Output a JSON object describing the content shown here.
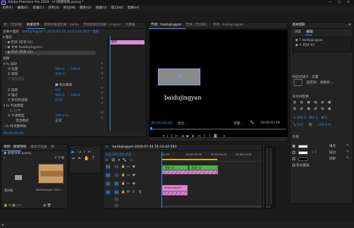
{
  "app": {
    "title": "Adobe Premiere Pro 2020 - H:\\新建项目.prproj *"
  },
  "menu": [
    "文件(F)",
    "编辑(E)",
    "剪辑(C)",
    "序列(S)",
    "标记(M)",
    "图形(G)",
    "视图(V)",
    "窗口(W)",
    "帮助(H)"
  ],
  "source_panel": {
    "tabs": [
      "源：(无剪辑)",
      "效果控件",
      "音频剪辑混合器：baidu",
      "音频剪辑混合器：jingyan",
      "元数据"
    ],
    "active_tab": "效果控件",
    "header": "主要＊图形",
    "sequence": "baidujingyan * 2020-07-24 14-13-42-563 * 图形",
    "sections": {
      "graphics": "图形",
      "shape": "形状 (形状 01)",
      "text": "文本 (baidujingyan)",
      "shape2": "形状 (形状 02)"
    },
    "video_label": "视频",
    "motion": "运动",
    "props": [
      {
        "name": "位置",
        "value": "960.0",
        "value2": "540.0"
      },
      {
        "name": "缩放",
        "value": "100.0"
      },
      {
        "name": "缩放宽度",
        "value": ""
      },
      {
        "name": "旋转",
        "value": "0.0"
      },
      {
        "name": "锚点",
        "value": "960.0",
        "value2": "540.0"
      },
      {
        "name": "防闪烁滤镜",
        "value": "0.00"
      }
    ],
    "uniform_scale": "等比缩放",
    "opacity": "不透明度",
    "opacity_props": [
      {
        "name": "不透明度",
        "value": "100.0 %"
      },
      {
        "name": "混合模式",
        "value": "正常"
      }
    ],
    "time_remap": "时间重映射",
    "timecode": "00;00;00;00"
  },
  "mini_timeline": {
    "clip_label": "图形"
  },
  "program_panel": {
    "tabs": [
      "节目：baidujingyan",
      "音频（无剪辑）",
      "参考：baidujingyan"
    ],
    "sequence_name": "baidujingyan 2020-07-24 14-13-42-563",
    "overlay_text": "baidujingyan",
    "timecode_left": "00;00;00;00",
    "fit": "适合",
    "quality": "完整",
    "timecode_right": "00;00;02;00"
  },
  "graphics_panel": {
    "title": "基本图形",
    "tabs": [
      "浏览",
      "编辑"
    ],
    "active_tab": "编辑",
    "layers": [
      {
        "name": "baidujingyan",
        "type": "text"
      },
      {
        "name": "形状 01",
        "type": "shape"
      }
    ],
    "responsive_label": "响应式设计 - 位置",
    "pin_label": "固定到：",
    "pin_value": "视频帧",
    "align_label": "对齐并变换",
    "values": {
      "x": "900.0",
      "y": "481.1",
      "scale": "100",
      "rotation": "0",
      "opacity": "100.0 %"
    },
    "appearance": "外观",
    "fill_label": "填充",
    "stroke_label": "描边",
    "shadow_label": "阴影",
    "mask_label": "形状蒙版",
    "stroke_value": "1.0",
    "colors": {
      "fill": "#ffffff",
      "stroke": "#ffffff",
      "shadow": "#000000"
    }
  },
  "project_panel": {
    "tabs": [
      "项目：新建项目",
      "媒体浏览器",
      "库"
    ],
    "project_file": "新建项目.prproj",
    "item_count": "2 个项",
    "items": [
      {
        "name": "素材箱",
        "count": "",
        "kind": "bin"
      },
      {
        "name": "baidujingyan 2020-...",
        "count": "1:07",
        "kind": "sequence"
      }
    ]
  },
  "timeline": {
    "tab": "baidujingyan 2020-07-24 14-13-42-563",
    "timecode": "00;00;00;00",
    "ruler": [
      "00;00",
      "00;00;05;00",
      "00;00;10;00",
      "00;00;15;00"
    ],
    "video_tracks": [
      "V3",
      "V2",
      "V1"
    ],
    "audio_tracks": [
      "A1",
      "A2",
      "A3"
    ],
    "clips": {
      "v3_a": "形状 01",
      "v3_b": "形状 01",
      "v2": "baidujingyan"
    }
  },
  "audio_meter": {
    "labels": [
      "0",
      "-12",
      "-24",
      "-36",
      "-48",
      "dB"
    ]
  },
  "tools": [
    "selection",
    "track-select",
    "ripple",
    "razor",
    "slip",
    "pen",
    "hand",
    "type"
  ]
}
